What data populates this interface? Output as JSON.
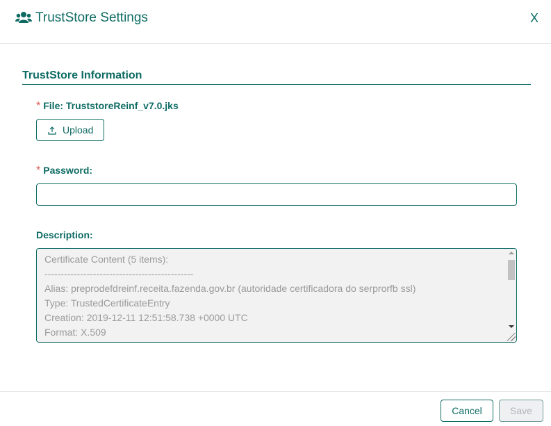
{
  "header": {
    "icon": "users-icon",
    "title": "TrustStore Settings",
    "close_label": "X"
  },
  "section": {
    "title": "TrustStore Information"
  },
  "file": {
    "required_mark": "*",
    "label": "File: TruststoreReinf_v7.0.jks",
    "upload_icon": "upload-icon",
    "upload_label": "Upload"
  },
  "password": {
    "required_mark": "*",
    "label": "Password:",
    "value": ""
  },
  "description": {
    "label": "Description:",
    "lines": [
      "Certificate Content (5 items):",
      "----------------------------------------------",
      "Alias: preprodefdreinf.receita.fazenda.gov.br (autoridade certificadora do serprorfb ssl)",
      "Type: TrustedCertificateEntry",
      "Creation: 2019-12-11 12:51:58.738 +0000 UTC",
      "Format: X.509"
    ]
  },
  "footer": {
    "cancel_label": "Cancel",
    "save_label": "Save"
  },
  "colors": {
    "accent": "#0d6b63",
    "required": "#d9534f",
    "readonly_bg": "#f2f2f2"
  }
}
